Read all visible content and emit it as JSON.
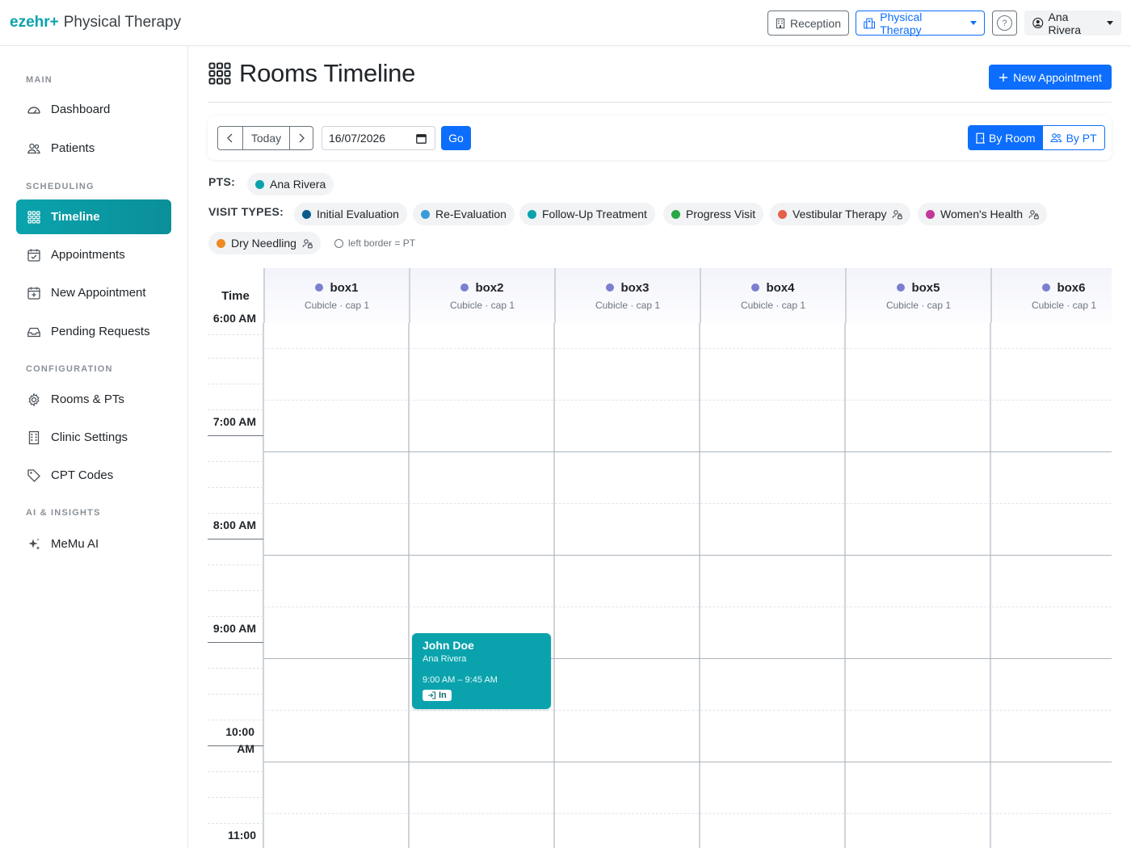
{
  "brand": {
    "logo": "ezehr+",
    "app_name": "Physical Therapy"
  },
  "topbar": {
    "reception_label": "Reception",
    "clinic_label": "Physical Therapy",
    "help_label": "?",
    "user_name": "Ana Rivera"
  },
  "sidebar": {
    "sections": {
      "main": "MAIN",
      "scheduling": "SCHEDULING",
      "configuration": "CONFIGURATION",
      "ai": "AI & INSIGHTS"
    },
    "items": [
      {
        "label": "Dashboard",
        "icon": "dashboard-icon"
      },
      {
        "label": "Patients",
        "icon": "people-icon"
      },
      {
        "label": "Timeline",
        "icon": "grid-icon",
        "active": true
      },
      {
        "label": "Appointments",
        "icon": "calendar-check-icon"
      },
      {
        "label": "New Appointment",
        "icon": "calendar-plus-icon"
      },
      {
        "label": "Pending Requests",
        "icon": "inbox-icon"
      },
      {
        "label": "Rooms & PTs",
        "icon": "gear-icon"
      },
      {
        "label": "Clinic Settings",
        "icon": "building-icon"
      },
      {
        "label": "CPT Codes",
        "icon": "tag-icon"
      },
      {
        "label": "MeMu AI",
        "icon": "sparkle-icon"
      }
    ]
  },
  "page": {
    "title": "Rooms Timeline",
    "new_appointment_label": "New Appointment"
  },
  "toolbar": {
    "today_label": "Today",
    "date_value": "16/07/2026",
    "go_label": "Go",
    "by_room_label": "By Room",
    "by_pt_label": "By PT"
  },
  "legend": {
    "pts_label": "PTS:",
    "pts": [
      {
        "name": "Ana Rivera",
        "color": "#0aa3ad"
      }
    ],
    "visit_types_label": "VISIT TYPES:",
    "visit_types": [
      {
        "name": "Initial Evaluation",
        "color": "#0b5c8a"
      },
      {
        "name": "Re-Evaluation",
        "color": "#3a9bd9"
      },
      {
        "name": "Follow-Up Treatment",
        "color": "#0aa3ad"
      },
      {
        "name": "Progress Visit",
        "color": "#28a745"
      },
      {
        "name": "Vestibular Therapy",
        "color": "#e4604a",
        "locked": true
      },
      {
        "name": "Women's Health",
        "color": "#c2399a",
        "locked": true
      },
      {
        "name": "Dry Needling",
        "color": "#f08a24",
        "locked": true
      }
    ],
    "border_note": "left border = PT"
  },
  "timeline": {
    "time_header": "Time",
    "room_dot_color": "#7b7fd0",
    "rooms": [
      {
        "name": "box1",
        "subtitle": "Cubicle · cap 1"
      },
      {
        "name": "box2",
        "subtitle": "Cubicle · cap 1"
      },
      {
        "name": "box3",
        "subtitle": "Cubicle · cap 1"
      },
      {
        "name": "box4",
        "subtitle": "Cubicle · cap 1"
      },
      {
        "name": "box5",
        "subtitle": "Cubicle · cap 1"
      },
      {
        "name": "box6",
        "subtitle": "Cubicle · cap 1"
      }
    ],
    "hours": [
      "6:00 AM",
      "7:00 AM",
      "8:00 AM",
      "9:00 AM",
      "10:00 AM",
      "11:00"
    ],
    "appointments": [
      {
        "room": "box2",
        "patient": "John Doe",
        "pt": "Ana Rivera",
        "time_range": "9:00 AM – 9:45 AM",
        "status": "In",
        "color": "#0aa3ad"
      }
    ]
  }
}
